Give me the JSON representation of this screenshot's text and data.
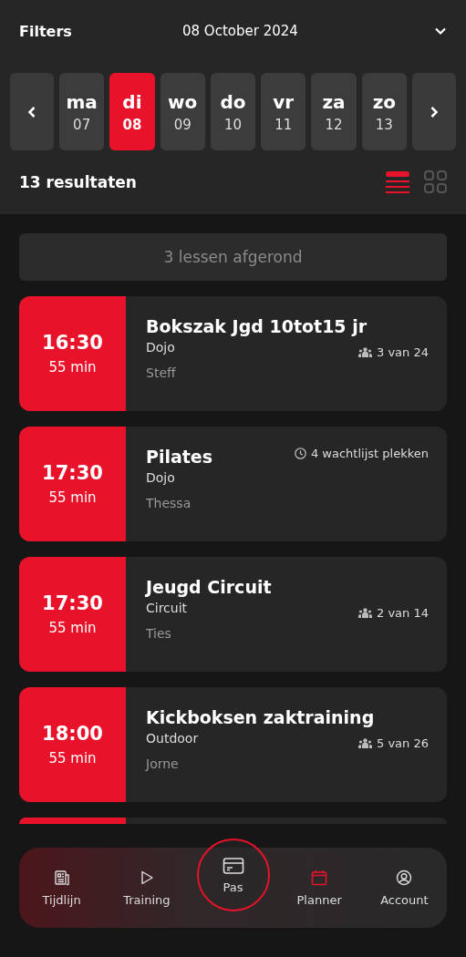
{
  "header": {
    "filters": "Filters",
    "date": "08 October 2024"
  },
  "days": [
    {
      "day": "ma",
      "num": "07",
      "selected": false
    },
    {
      "day": "di",
      "num": "08",
      "selected": true
    },
    {
      "day": "wo",
      "num": "09",
      "selected": false
    },
    {
      "day": "do",
      "num": "10",
      "selected": false
    },
    {
      "day": "vr",
      "num": "11",
      "selected": false
    },
    {
      "day": "za",
      "num": "12",
      "selected": false
    },
    {
      "day": "zo",
      "num": "13",
      "selected": false
    }
  ],
  "results": "13 resultaten",
  "views": [
    {
      "kind": "list",
      "selected": true
    },
    {
      "kind": "grid",
      "selected": false
    }
  ],
  "completed": "3 lessen afgerond",
  "lessons": [
    {
      "time": "16:30",
      "duration": "55 min",
      "title": "Bokszak Jgd 10tot15 jr",
      "location": "Dojo",
      "trainer": "Steff",
      "kind": "capacity",
      "info": "3 van 24"
    },
    {
      "time": "17:30",
      "duration": "55 min",
      "title": "Pilates",
      "location": "Dojo",
      "trainer": "Thessa",
      "kind": "waitlist",
      "info": "4 wachtlijst plekken"
    },
    {
      "time": "17:30",
      "duration": "55 min",
      "title": "Jeugd Circuit",
      "location": "Circuit",
      "trainer": "Ties",
      "kind": "capacity",
      "info": "2 van 14"
    },
    {
      "time": "18:00",
      "duration": "55 min",
      "title": "Kickboksen zaktraining",
      "location": "Outdoor",
      "trainer": "Jorne",
      "kind": "capacity",
      "info": "5 van 26"
    }
  ],
  "more_below": true,
  "nav": [
    {
      "kind": "news",
      "label": "Tijdlijn",
      "selected": false
    },
    {
      "kind": "play",
      "label": "Training",
      "selected": false
    },
    {
      "kind": "card",
      "label": "Pas",
      "selected": false
    },
    {
      "kind": "calendar",
      "label": "Planner",
      "selected": true
    },
    {
      "kind": "account",
      "label": "Account",
      "selected": false
    }
  ]
}
